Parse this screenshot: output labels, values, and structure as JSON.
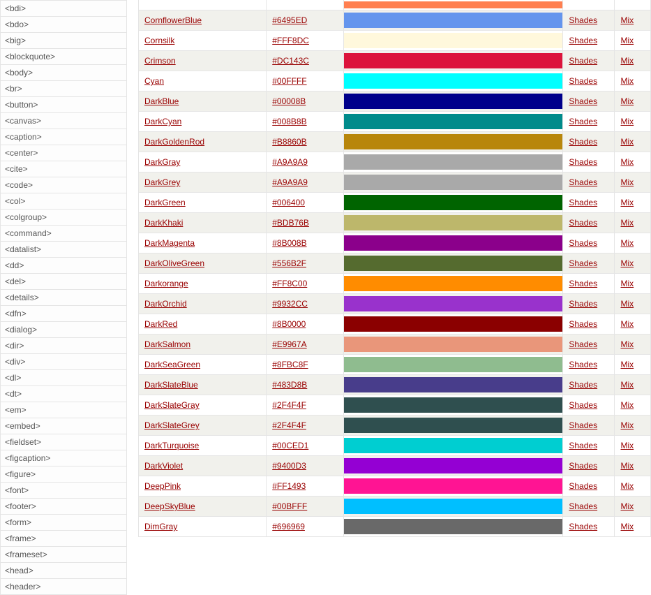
{
  "sidebar": {
    "tags": [
      "<bdi>",
      "<bdo>",
      "<big>",
      "<blockquote>",
      "<body>",
      "<br>",
      "<button>",
      "<canvas>",
      "<caption>",
      "<center>",
      "<cite>",
      "<code>",
      "<col>",
      "<colgroup>",
      "<command>",
      "<datalist>",
      "<dd>",
      "<del>",
      "<details>",
      "<dfn>",
      "<dialog>",
      "<dir>",
      "<div>",
      "<dl>",
      "<dt>",
      "<em>",
      "<embed>",
      "<fieldset>",
      "<figcaption>",
      "<figure>",
      "<font>",
      "<footer>",
      "<form>",
      "<frame>",
      "<frameset>",
      "<head>",
      "<header>"
    ]
  },
  "table": {
    "shades_label": "Shades",
    "mix_label": "Mix",
    "rows": [
      {
        "name": "",
        "hex": "",
        "swatch": "#FF7F50",
        "top": true
      },
      {
        "name": "CornflowerBlue",
        "hex": "#6495ED",
        "swatch": "#6495ED"
      },
      {
        "name": "Cornsilk",
        "hex": "#FFF8DC",
        "swatch": "#FFF8DC"
      },
      {
        "name": "Crimson",
        "hex": "#DC143C",
        "swatch": "#DC143C"
      },
      {
        "name": "Cyan",
        "hex": "#00FFFF",
        "swatch": "#00FFFF"
      },
      {
        "name": "DarkBlue",
        "hex": "#00008B",
        "swatch": "#00008B"
      },
      {
        "name": "DarkCyan",
        "hex": "#008B8B",
        "swatch": "#008B8B"
      },
      {
        "name": "DarkGoldenRod",
        "hex": "#B8860B",
        "swatch": "#B8860B"
      },
      {
        "name": "DarkGray",
        "hex": "#A9A9A9",
        "swatch": "#A9A9A9"
      },
      {
        "name": "DarkGrey",
        "hex": "#A9A9A9",
        "swatch": "#A9A9A9"
      },
      {
        "name": "DarkGreen",
        "hex": "#006400",
        "swatch": "#006400"
      },
      {
        "name": "DarkKhaki",
        "hex": "#BDB76B",
        "swatch": "#BDB76B"
      },
      {
        "name": "DarkMagenta",
        "hex": "#8B008B",
        "swatch": "#8B008B"
      },
      {
        "name": "DarkOliveGreen",
        "hex": "#556B2F",
        "swatch": "#556B2F"
      },
      {
        "name": "Darkorange",
        "hex": "#FF8C00",
        "swatch": "#FF8C00"
      },
      {
        "name": "DarkOrchid",
        "hex": "#9932CC",
        "swatch": "#9932CC"
      },
      {
        "name": "DarkRed",
        "hex": "#8B0000",
        "swatch": "#8B0000"
      },
      {
        "name": "DarkSalmon",
        "hex": "#E9967A",
        "swatch": "#E9967A"
      },
      {
        "name": "DarkSeaGreen",
        "hex": "#8FBC8F",
        "swatch": "#8FBC8F"
      },
      {
        "name": "DarkSlateBlue",
        "hex": "#483D8B",
        "swatch": "#483D8B"
      },
      {
        "name": "DarkSlateGray",
        "hex": "#2F4F4F",
        "swatch": "#2F4F4F"
      },
      {
        "name": "DarkSlateGrey",
        "hex": "#2F4F4F",
        "swatch": "#2F4F4F"
      },
      {
        "name": "DarkTurquoise",
        "hex": "#00CED1",
        "swatch": "#00CED1"
      },
      {
        "name": "DarkViolet",
        "hex": "#9400D3",
        "swatch": "#9400D3"
      },
      {
        "name": "DeepPink",
        "hex": "#FF1493",
        "swatch": "#FF1493"
      },
      {
        "name": "DeepSkyBlue",
        "hex": "#00BFFF",
        "swatch": "#00BFFF"
      },
      {
        "name": "DimGray",
        "hex": "#696969",
        "swatch": "#696969"
      }
    ]
  }
}
